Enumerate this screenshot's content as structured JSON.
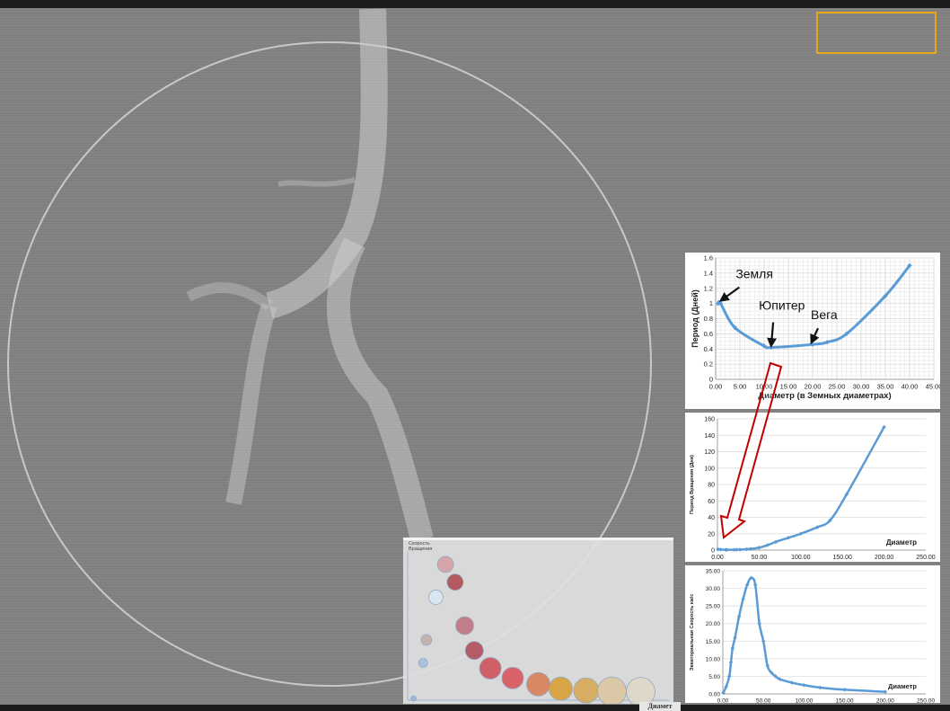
{
  "colors": {
    "background": "#808080",
    "series": "#5b9bd5",
    "grid": "#d0d0d0",
    "arrow_outline": "#c00000",
    "highlight_frame": "#e8a817"
  },
  "chart_data": [
    {
      "type": "line",
      "xlabel": "Диаметр (в Земных диаметрах)",
      "ylabel": "Период (Дней)",
      "xlim": [
        0,
        45
      ],
      "ylim": [
        0,
        1.6
      ],
      "xticks": [
        "0.00",
        "5.00",
        "10.00",
        "15.00",
        "20.00",
        "25.00",
        "30.00",
        "35.00",
        "40.00",
        "45.00"
      ],
      "yticks": [
        "0",
        "0.2",
        "0.4",
        "0.6",
        "0.8",
        "1",
        "1.2",
        "1.4",
        "1.6"
      ],
      "grid": "fine",
      "series": [
        {
          "x": [
            0.5,
            1.0,
            4.0,
            10.0,
            11.5,
            20.0,
            23.0,
            27.0,
            35.0,
            40.0
          ],
          "y": [
            1.0,
            1.0,
            0.68,
            0.44,
            0.42,
            0.46,
            0.49,
            0.6,
            1.1,
            1.5
          ]
        }
      ],
      "annotations": [
        {
          "text": "Земля",
          "x": 0.8,
          "y": 1.0
        },
        {
          "text": "Юпитер",
          "x": 11.5,
          "y": 0.42
        },
        {
          "text": "Вега",
          "x": 20.0,
          "y": 0.46
        }
      ]
    },
    {
      "type": "line",
      "xlabel": "Диаметр",
      "ylabel": "Период Вращения (Дни)",
      "xlim": [
        0,
        250
      ],
      "ylim": [
        0,
        160
      ],
      "xticks": [
        "0.00",
        "50.00",
        "100.00",
        "150.00",
        "200.00",
        "250.00"
      ],
      "yticks": [
        "0",
        "20",
        "40",
        "60",
        "80",
        "100",
        "120",
        "140",
        "160"
      ],
      "series": [
        {
          "x": [
            0.5,
            1,
            4,
            10,
            11.5,
            20,
            23,
            27,
            35,
            40,
            50,
            60,
            70,
            85,
            100,
            120,
            135,
            155,
            200
          ],
          "y": [
            1,
            1,
            0.7,
            0.45,
            0.42,
            0.46,
            0.5,
            0.6,
            1.1,
            1.5,
            3,
            6,
            10,
            15,
            20,
            28,
            36,
            68,
            150
          ]
        }
      ]
    },
    {
      "type": "line",
      "xlabel": "Диаметр",
      "ylabel": "Экваториальная Скорость км/с",
      "xlim": [
        0,
        250
      ],
      "ylim": [
        0,
        35
      ],
      "xticks": [
        "0.00",
        "50.00",
        "100.00",
        "150.00",
        "200.00",
        "250.00"
      ],
      "yticks": [
        "0.00",
        "5.00",
        "10.00",
        "15.00",
        "20.00",
        "25.00",
        "30.00",
        "35.00"
      ],
      "series": [
        {
          "x": [
            0.5,
            4,
            8,
            10,
            12,
            15,
            20,
            25,
            30,
            35,
            40,
            45,
            50,
            55,
            60,
            65,
            70,
            85,
            100,
            120,
            150,
            200
          ],
          "y": [
            0.3,
            2,
            5,
            9,
            13,
            16,
            22,
            27,
            31,
            33,
            31,
            20,
            15,
            8,
            6,
            5,
            4.2,
            3.2,
            2.5,
            1.8,
            1.2,
            0.6
          ]
        }
      ]
    },
    {
      "type": "scatter",
      "title_lines": [
        "Скорость",
        "Вращения"
      ],
      "xlabel": "Диамет",
      "points": [
        {
          "x": 1,
          "y": 0.2,
          "size": 3,
          "color": "#9bb7d4"
        },
        {
          "x": 4,
          "y": 4.2,
          "size": 5,
          "color": "#a9c1dc"
        },
        {
          "x": 5,
          "y": 6.8,
          "size": 6,
          "color": "#c4b0ad"
        },
        {
          "x": 8,
          "y": 11.6,
          "size": 8,
          "color": "#dce6f2"
        },
        {
          "x": 11,
          "y": 15.3,
          "size": 9,
          "color": "#d4a4a6"
        },
        {
          "x": 14,
          "y": 13.3,
          "size": 9,
          "color": "#b3535a"
        },
        {
          "x": 17,
          "y": 8.4,
          "size": 10,
          "color": "#c07a84"
        },
        {
          "x": 20,
          "y": 5.6,
          "size": 10,
          "color": "#b35561"
        },
        {
          "x": 25,
          "y": 3.6,
          "size": 12,
          "color": "#cf5a62"
        },
        {
          "x": 32,
          "y": 2.5,
          "size": 12,
          "color": "#d95b62"
        },
        {
          "x": 40,
          "y": 1.8,
          "size": 13,
          "color": "#d8845e"
        },
        {
          "x": 47,
          "y": 1.3,
          "size": 13,
          "color": "#d7a33f"
        },
        {
          "x": 55,
          "y": 1.1,
          "size": 14,
          "color": "#d7ab5e"
        },
        {
          "x": 63,
          "y": 1.0,
          "size": 16,
          "color": "#dcc8a4"
        },
        {
          "x": 72,
          "y": 0.95,
          "size": 16,
          "color": "#ded8c8"
        }
      ]
    }
  ]
}
